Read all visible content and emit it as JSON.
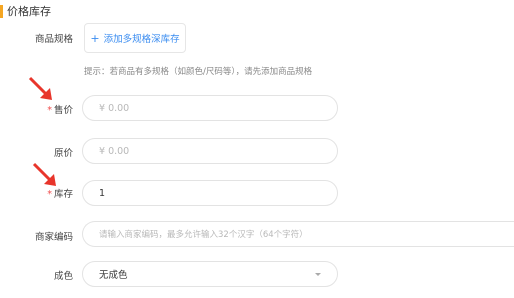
{
  "section": {
    "title": "价格库存"
  },
  "spec": {
    "label": "商品规格",
    "button_label": "添加多规格深库存",
    "hint": "提示：若商品有多规格（如颜色/尺码等），请先添加商品规格"
  },
  "price": {
    "label": "售价",
    "required": "*",
    "placeholder": "¥ 0.00"
  },
  "original_price": {
    "label": "原价",
    "placeholder": "¥ 0.00"
  },
  "stock": {
    "label": "库存",
    "required": "*",
    "value": "1"
  },
  "merchant_code": {
    "label": "商家编码",
    "placeholder": "请输入商家编码，最多允许输入32个汉字（64个字符）"
  },
  "condition": {
    "label": "成色",
    "value": "无成色"
  },
  "colors": {
    "accent": "#f5a623",
    "link": "#3a8cf0",
    "required": "#f04d4d",
    "annotation_arrow": "#e8352b"
  }
}
